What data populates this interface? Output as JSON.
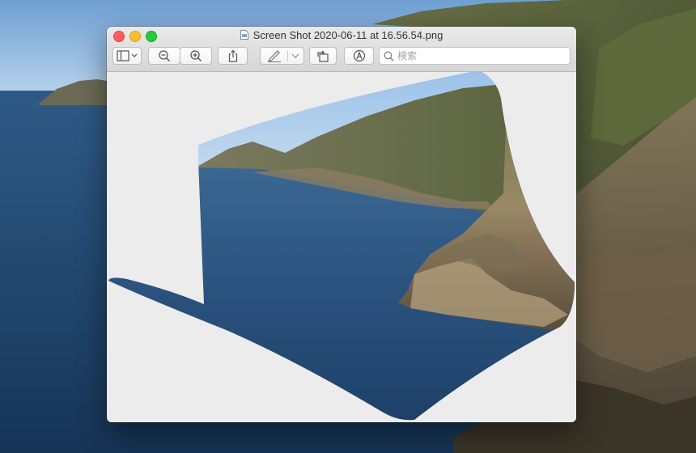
{
  "window": {
    "title": "Screen Shot 2020-06-11 at 16.56.54.png"
  },
  "toolbar": {
    "search_placeholder": "検索"
  },
  "icons": {
    "sidebar": "sidebar-icon",
    "zoom_out": "zoom-out-icon",
    "zoom_in": "zoom-in-icon",
    "share": "share-icon",
    "markup": "pen-icon",
    "rotate": "rotate-icon",
    "annotate": "markup-icon",
    "search": "search-icon"
  },
  "colors": {
    "close": "#fe5f57",
    "minimize": "#febc2e",
    "maximize": "#28c840",
    "sky": "#8fb9e3",
    "ocean": "#2a4f7a"
  }
}
